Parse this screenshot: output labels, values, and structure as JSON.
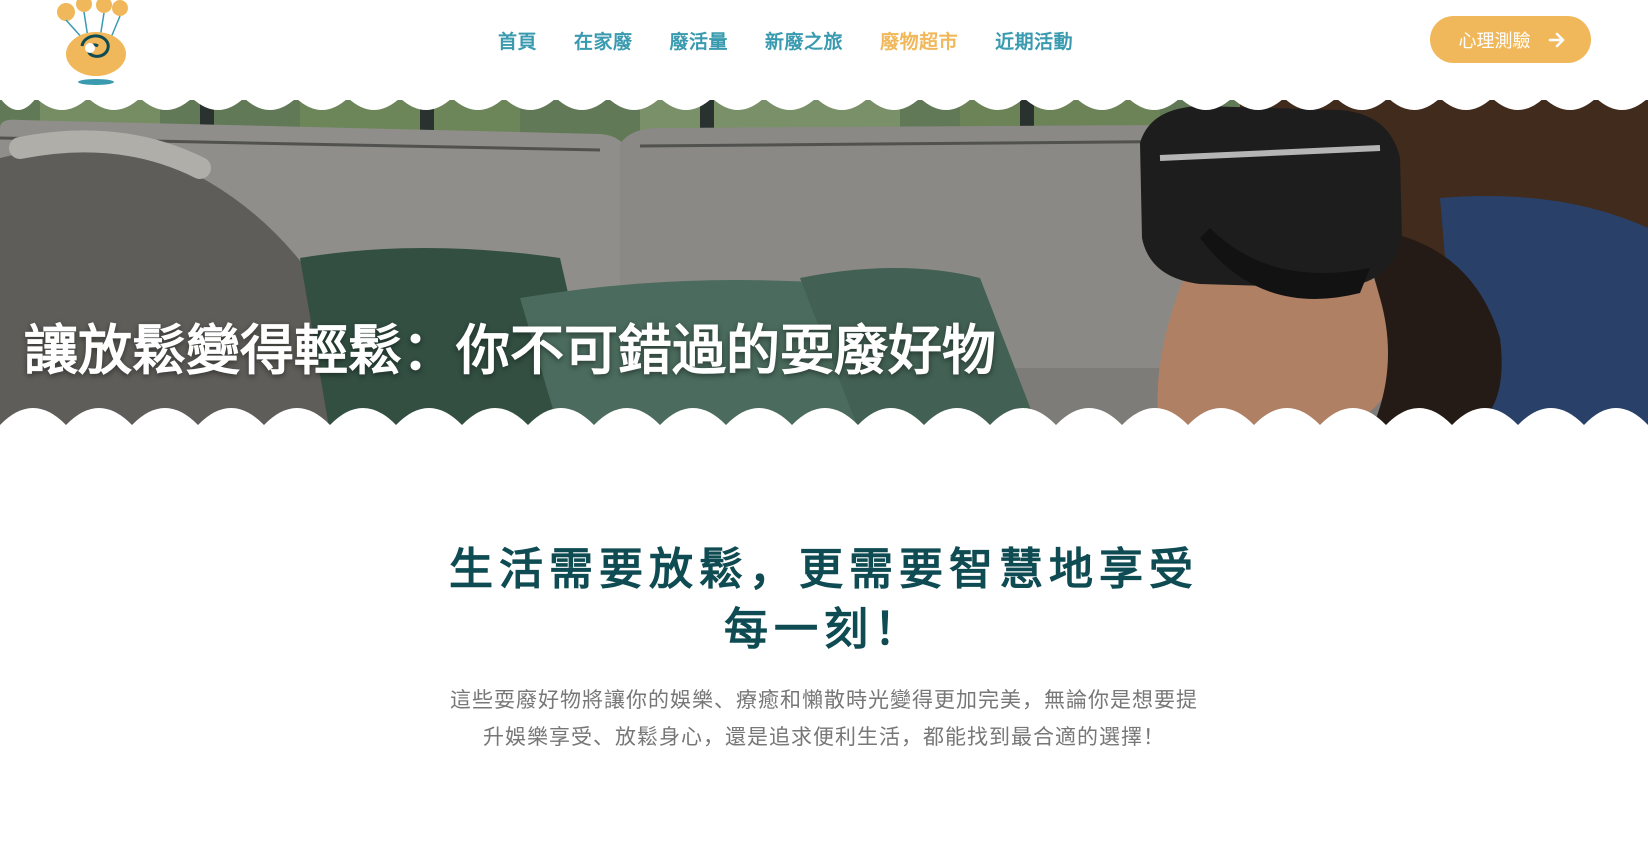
{
  "header": {
    "logo_icon": "balloon-mascot-logo",
    "nav": [
      {
        "label": "首頁",
        "active": false
      },
      {
        "label": "在家廢",
        "active": false
      },
      {
        "label": "廢活量",
        "active": false
      },
      {
        "label": "新廢之旅",
        "active": false
      },
      {
        "label": "廢物超市",
        "active": true
      },
      {
        "label": "近期活動",
        "active": false
      }
    ],
    "cta_label": "心理測驗",
    "cta_icon": "arrow-right-icon"
  },
  "hero": {
    "title": "讓放鬆變得輕鬆：你不可錯過的耍廢好物",
    "image": "woman-relaxing-on-sofa-with-vr-headset"
  },
  "content": {
    "heading": "生活需要放鬆，更需要智慧地享受每一刻！",
    "description": "這些耍廢好物將讓你的娛樂、療癒和懶散時光變得更加完美，無論你是想要提升娛樂享受、放鬆身心，還是追求便利生活，都能找到最合適的選擇！"
  },
  "colors": {
    "nav": "#3a9bb0",
    "nav_active": "#f0b85a",
    "cta_bg": "#f0b85a",
    "heading": "#0f4b52",
    "body_text": "#777777"
  }
}
